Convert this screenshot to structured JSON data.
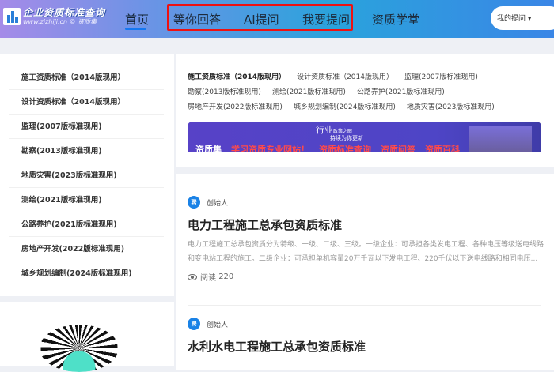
{
  "header": {
    "logo_title": "企业资质标准查询",
    "logo_url": "www.zizhiji.cn",
    "logo_brand": "资质集",
    "nav": [
      "首页",
      "等你回答",
      "AI提问",
      "我要提问",
      "资质学堂"
    ],
    "my_questions": "我的提问"
  },
  "sidebar": {
    "items": [
      "施工资质标准（2014版现用）",
      "设计资质标准（2014版现用）",
      "监理(2007版标准现用)",
      "勘察(2013版标准现用)",
      "地质灾害(2023版标准现用)",
      "测绘(2021版标准现用)",
      "公路养护(2021版标准现用)",
      "房地产开发(2022版标准现用)",
      "城乡规划编制(2024版标准现用)"
    ]
  },
  "tags": [
    [
      "施工资质标准（2014版现用）",
      "设计资质标准（2014版现用）",
      "监理(2007版标准现用)"
    ],
    [
      "勘察(2013版标准现用)",
      "测绘(2021版标准现用)",
      "公路养护(2021版标准现用)"
    ],
    [
      "房地产开发(2022版标准现用)",
      "城乡规划编制(2024版标准现用)",
      "地质灾害(2023版标准现用)"
    ]
  ],
  "banner": {
    "line1": "行业",
    "line1_small": "政策之眼",
    "line2": "持续为你更新",
    "brand": "资质集",
    "slogans": [
      "学习资质专业网站！",
      "资质标准查询",
      "资质问答",
      "资质百科"
    ]
  },
  "articles": [
    {
      "avatar": "聘",
      "author": "创始人",
      "title": "电力工程施工总承包资质标准",
      "desc": "电力工程施工总承包资质分为特级、一级、二级、三级。一级企业：可承担各类发电工程、各种电压等级送电线路和变电站工程的施工。二级企业：可承担单机容量20万千瓦以下发电工程、220千伏以下送电线路和相同电压...",
      "reads_label": "阅读",
      "reads": "220"
    },
    {
      "avatar": "聘",
      "author": "创始人",
      "title": "水利水电工程施工总承包资质标准"
    }
  ]
}
